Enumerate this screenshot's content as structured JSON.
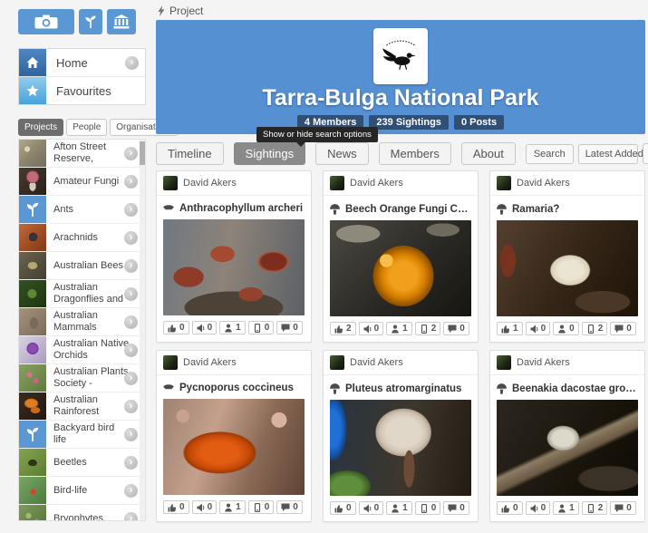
{
  "header": {
    "page_label": "Project",
    "icon": "project-bolt-icon"
  },
  "topbar": {
    "buttons": [
      {
        "icon": "camera-icon"
      },
      {
        "icon": "seedling-icon"
      },
      {
        "icon": "museum-icon"
      }
    ]
  },
  "nav": {
    "items": [
      {
        "label": "Home",
        "icon": "home-icon"
      },
      {
        "label": "Favourites",
        "icon": "star-icon"
      }
    ]
  },
  "sidebar_tabs": {
    "items": [
      {
        "label": "Projects",
        "active": true
      },
      {
        "label": "People",
        "active": false
      },
      {
        "label": "Organisations",
        "active": false
      }
    ]
  },
  "projects": [
    {
      "label": "Afton Street Reserve,"
    },
    {
      "label": "Amateur Fungi"
    },
    {
      "label": "Ants"
    },
    {
      "label": "Arachnids"
    },
    {
      "label": "Australian Bees"
    },
    {
      "label": "Australian Dragonflies and"
    },
    {
      "label": "Australian Mammals"
    },
    {
      "label": "Australian Native Orchids"
    },
    {
      "label": "Australian Plants Society -"
    },
    {
      "label": "Australian Rainforest"
    },
    {
      "label": "Backyard bird life"
    },
    {
      "label": "Beetles"
    },
    {
      "label": "Bird-life"
    },
    {
      "label": "Bryophytes"
    }
  ],
  "banner": {
    "title": "Tarra-Bulga National Park",
    "badges": [
      "4 Members",
      "239 Sightings",
      "0 Posts"
    ],
    "colors": {
      "banner_blue": "#5590d2",
      "badge_navy": "#2f4f75"
    }
  },
  "main_tabs": [
    {
      "label": "Timeline",
      "active": false
    },
    {
      "label": "Sightings",
      "active": true
    },
    {
      "label": "News",
      "active": false
    },
    {
      "label": "Members",
      "active": false
    },
    {
      "label": "About",
      "active": false
    }
  ],
  "controls": {
    "search": "Search",
    "sort": "Latest Added",
    "views": [
      "grid-view-icon",
      "list-view-icon"
    ]
  },
  "tooltip": {
    "text": "Show or hide search options"
  },
  "stat_icons": [
    "vote-icon",
    "megaphone-icon",
    "person-icon",
    "mobile-icon",
    "comment-icon"
  ],
  "cards": [
    {
      "author": "David Akers",
      "species_icon": "bracket-fungus-icon",
      "title": "Anthracophyllum archeri",
      "stats": [
        0,
        0,
        1,
        0,
        0
      ]
    },
    {
      "author": "David Akers",
      "species_icon": "mushroom-icon",
      "title": "Beech Orange Fungi Cyttari...",
      "stats": [
        2,
        0,
        1,
        2,
        0
      ]
    },
    {
      "author": "David Akers",
      "species_icon": "mushroom-icon",
      "title": "Ramaria?",
      "stats": [
        1,
        0,
        0,
        2,
        0
      ]
    },
    {
      "author": "David Akers",
      "species_icon": "bracket-fungus-icon",
      "title": "Pycnoporus coccineus",
      "stats": [
        0,
        0,
        1,
        0,
        0
      ]
    },
    {
      "author": "David Akers",
      "species_icon": "mushroom-icon",
      "title": "Pluteus atromarginatus",
      "stats": [
        0,
        0,
        1,
        0,
        0
      ]
    },
    {
      "author": "David Akers",
      "species_icon": "mushroom-icon",
      "title": "Beenakia dacostae growing ...",
      "stats": [
        0,
        0,
        1,
        2,
        0
      ]
    }
  ]
}
